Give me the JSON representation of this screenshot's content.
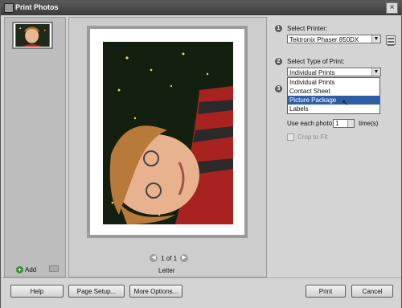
{
  "window": {
    "title": "Print Photos"
  },
  "left": {
    "add_label": "Add"
  },
  "preview": {
    "page_indicator": "1 of 1",
    "paper_name": "Letter"
  },
  "right": {
    "step1_label": "Select Printer:",
    "printer_value": "Tektronix Phaser 850DX",
    "step2_label": "Select Type of Print:",
    "print_type_value": "Individual Prints",
    "print_type_options": [
      "Individual Prints",
      "Contact Sheet",
      "Picture Package",
      "Labels"
    ],
    "highlighted_option": "Picture Package",
    "use_each_label": "Use each photo",
    "use_each_value": "1",
    "times_label": "time(s)",
    "crop_label": "Crop to Fit",
    "steps": [
      "1",
      "2",
      "3"
    ]
  },
  "buttons": {
    "help": "Help",
    "page_setup": "Page Setup...",
    "more_options": "More Options...",
    "print": "Print",
    "cancel": "Cancel"
  },
  "icons": {
    "app": "print-photos-icon",
    "close": "close-icon",
    "add": "plus-icon",
    "prev": "chevron-left-icon",
    "next": "chevron-right-icon",
    "properties": "printer-properties-icon"
  }
}
